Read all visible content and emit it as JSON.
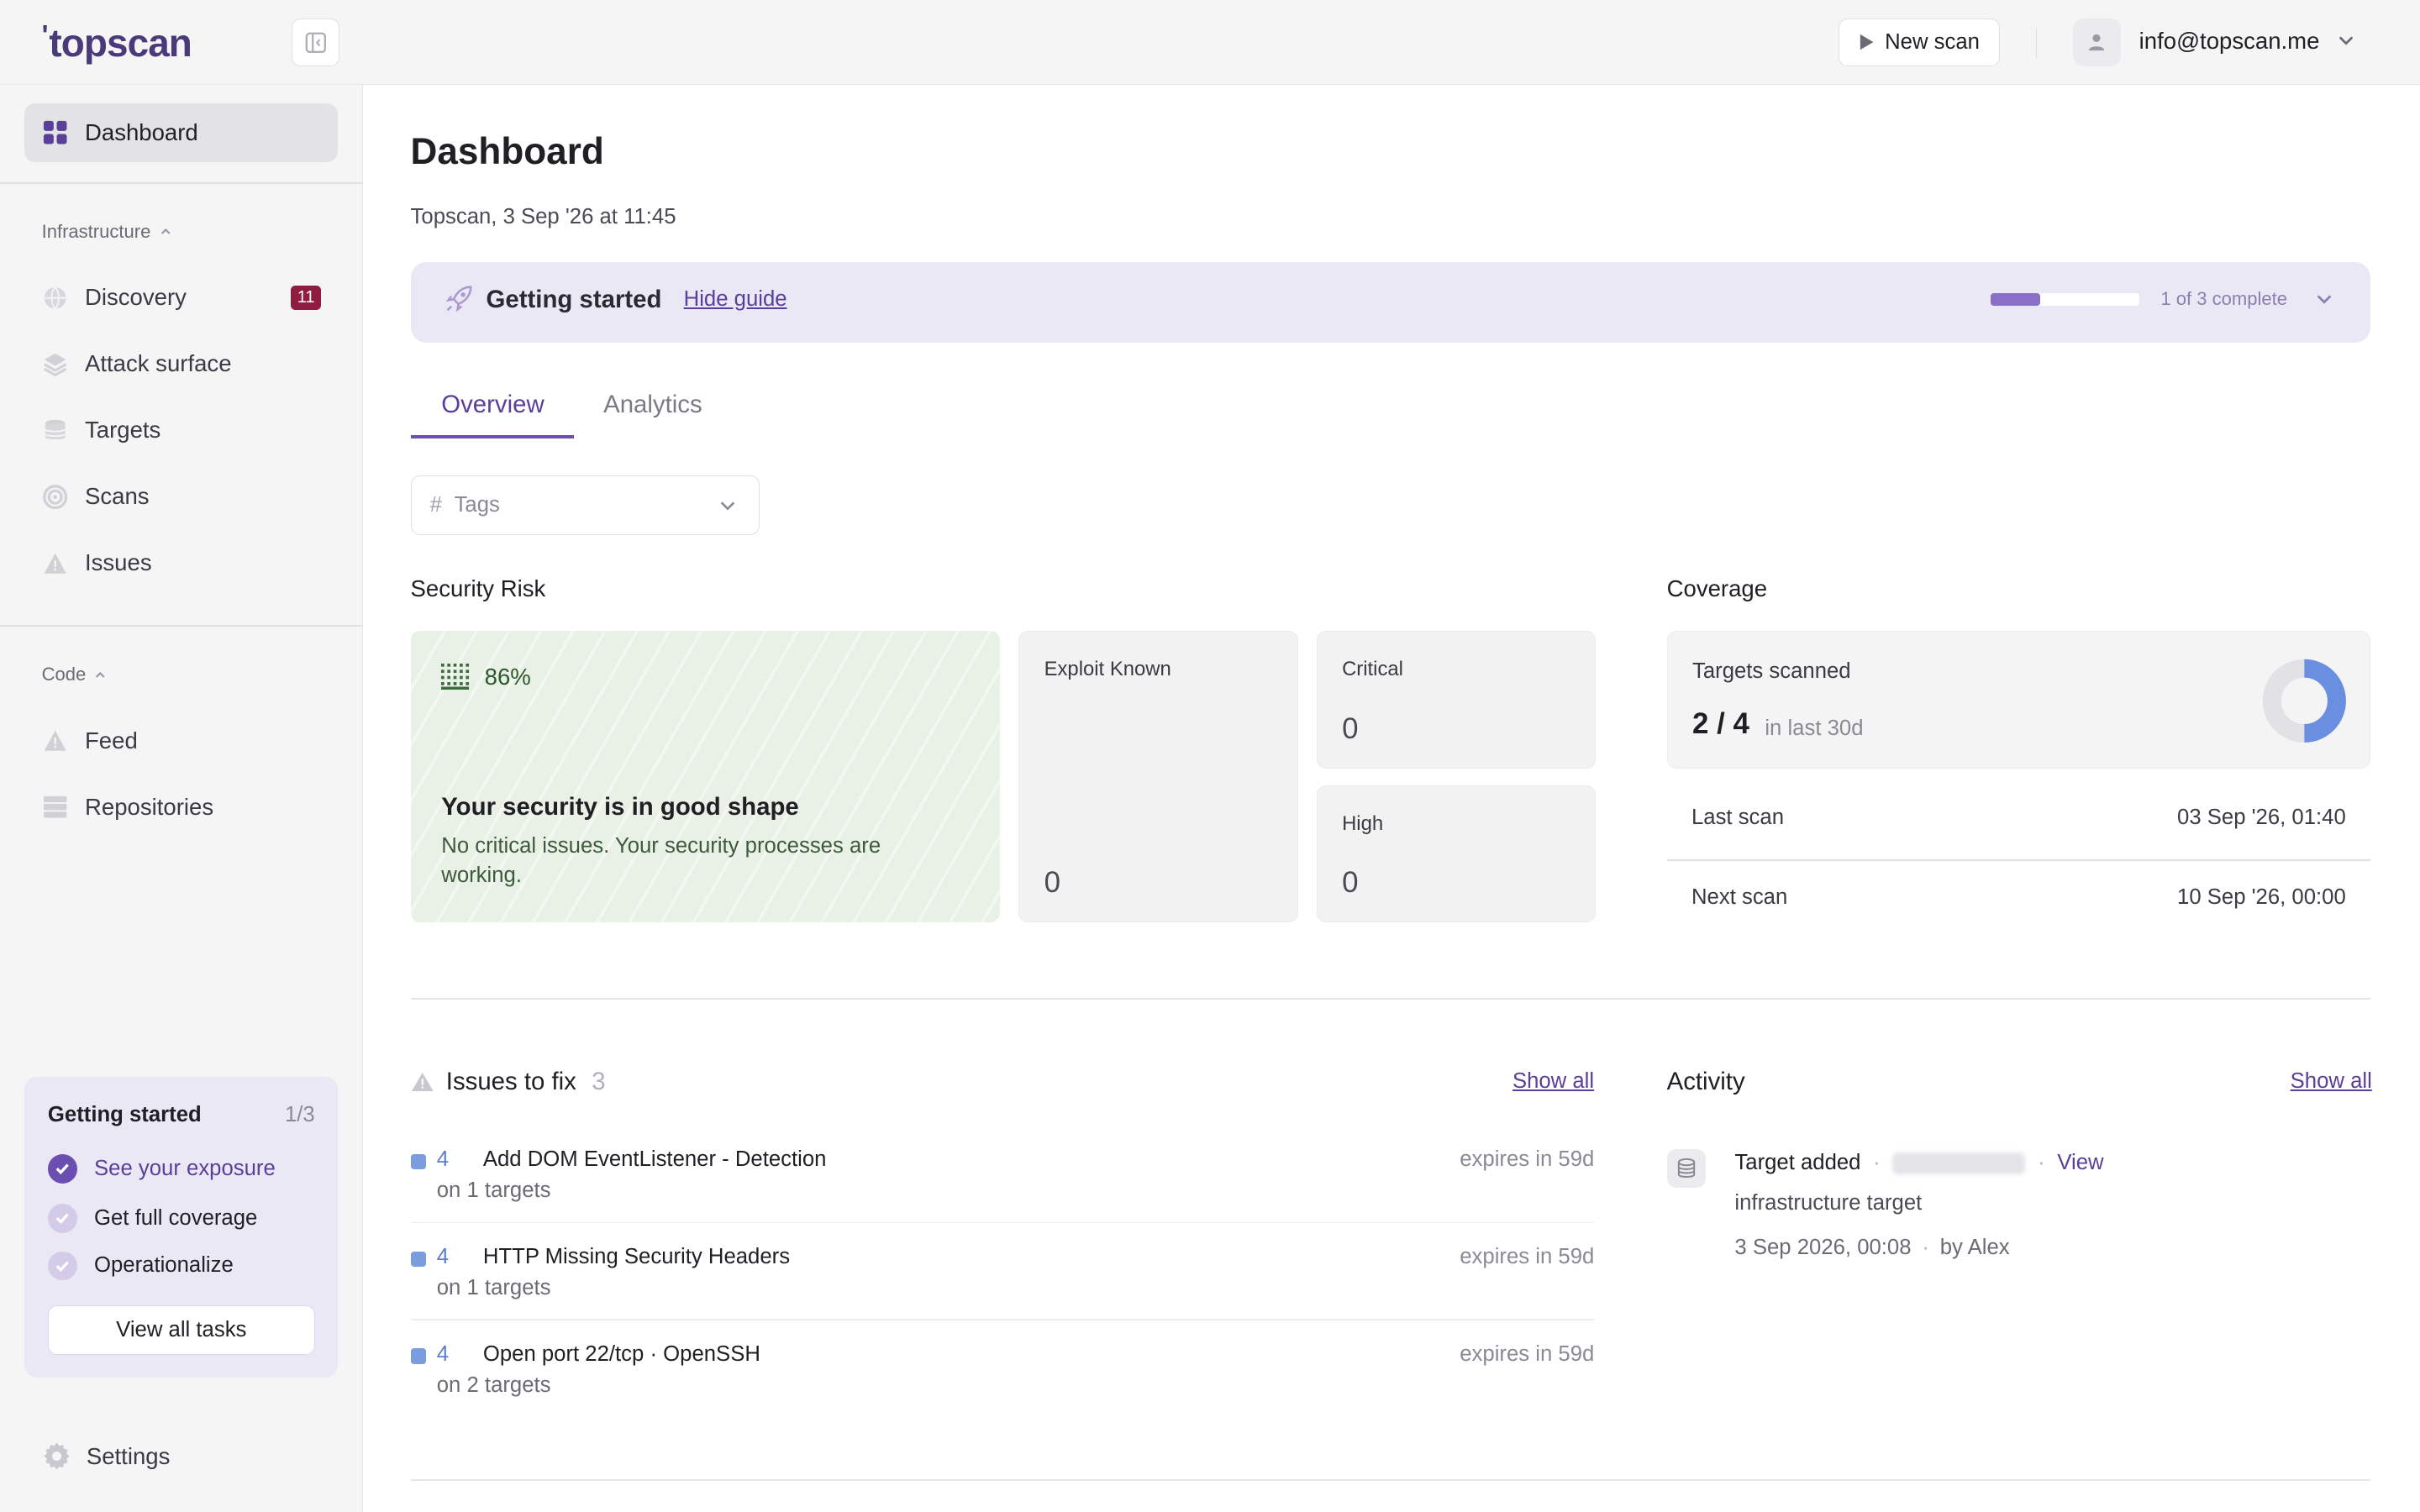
{
  "brand": {
    "logo": "topscan"
  },
  "header": {
    "new_scan_label": "New scan",
    "user_email": "info@topscan.me"
  },
  "sidebar": {
    "dashboard": "Dashboard",
    "infrastructure_section": "Infrastructure",
    "infrastructure_items": [
      {
        "label": "Discovery",
        "icon": "globe-icon",
        "badge": "11"
      },
      {
        "label": "Attack surface",
        "icon": "layers-icon"
      },
      {
        "label": "Targets",
        "icon": "database-icon"
      },
      {
        "label": "Scans",
        "icon": "target-icon"
      },
      {
        "label": "Issues",
        "icon": "warning-icon"
      }
    ],
    "code_section": "Code",
    "code_items": [
      {
        "label": "Feed",
        "icon": "warning-icon"
      },
      {
        "label": "Repositories",
        "icon": "server-icon"
      }
    ],
    "getting_started": {
      "title": "Getting started",
      "count": "1/3",
      "tasks": [
        {
          "label": "See your exposure",
          "done": true
        },
        {
          "label": "Get full coverage",
          "done": false
        },
        {
          "label": "Operationalize",
          "done": false
        }
      ],
      "button": "View all tasks"
    },
    "settings": "Settings"
  },
  "main": {
    "title": "Dashboard",
    "subtitle": "Topscan, 3 Sep '26 at 11:45",
    "guide": {
      "title": "Getting started",
      "hide_label": "Hide guide",
      "progress_fraction": 0.333,
      "status": "1 of 3 complete"
    },
    "tabs": [
      {
        "label": "Overview",
        "active": true
      },
      {
        "label": "Analytics",
        "active": false
      }
    ],
    "tags_placeholder": "Tags",
    "security_risk": {
      "heading": "Security Risk",
      "score": "86%",
      "headline": "Your security is in good shape",
      "text": "No critical issues. Your security processes are working.",
      "exploit_known_label": "Exploit Known",
      "exploit_known_value": "0",
      "critical_label": "Critical",
      "critical_value": "0",
      "high_label": "High",
      "high_value": "0"
    },
    "coverage": {
      "heading": "Coverage",
      "targets_label": "Targets scanned",
      "targets_value": "2 / 4",
      "targets_sub": "in last 30d",
      "scanned_fraction": 0.5,
      "last_scan_label": "Last scan",
      "last_scan_value": "03 Sep '26, 01:40",
      "next_scan_label": "Next scan",
      "next_scan_value": "10 Sep '26, 00:00"
    },
    "issues": {
      "heading": "Issues to fix",
      "count": "3",
      "show_all": "Show all",
      "rows": [
        {
          "count": "4",
          "name": "Add DOM EventListener - Detection",
          "targets": "on 1 targets",
          "expires": "expires in 59d"
        },
        {
          "count": "4",
          "name": "HTTP Missing Security Headers",
          "targets": "on 1 targets",
          "expires": "expires in 59d"
        },
        {
          "count": "4",
          "name": "Open port 22/tcp · OpenSSH",
          "targets": "on 2 targets",
          "expires": "expires in 59d"
        }
      ]
    },
    "activity": {
      "heading": "Activity",
      "show_all": "Show all",
      "event_title": "Target added",
      "event_view": "View",
      "event_type": "infrastructure target",
      "event_time": "3 Sep 2026, 00:08",
      "event_by": "by Alex"
    }
  },
  "colors": {
    "accent": "#6a4fb0",
    "badge": "#8e1d3f",
    "risk_good_bg": "#e9f0e6",
    "donut_fill": "#6b8fe0"
  }
}
